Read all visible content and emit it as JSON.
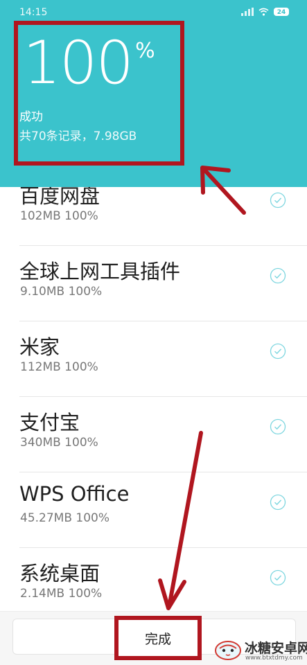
{
  "status_bar": {
    "time": "14:15",
    "battery": "24"
  },
  "header": {
    "percent_value": "100",
    "percent_sign": "%",
    "status": "成功",
    "summary": "共70条记录，7.98GB"
  },
  "apps": [
    {
      "name": "百度网盘",
      "meta": "102MB 100%",
      "completed": true
    },
    {
      "name": "全球上网工具插件",
      "meta": "9.10MB 100%",
      "completed": true
    },
    {
      "name": "米家",
      "meta": "112MB 100%",
      "completed": true
    },
    {
      "name": "支付宝",
      "meta": "340MB 100%",
      "completed": true
    },
    {
      "name": "WPS Office",
      "meta": "45.27MB 100%",
      "completed": true
    },
    {
      "name": "系统桌面",
      "meta": "2.14MB 100%",
      "completed": true
    }
  ],
  "footer": {
    "done_label": "完成"
  },
  "watermark": {
    "brand": "冰糖安卓网",
    "url": "www.btxtdmy.com"
  },
  "colors": {
    "header_bg": "#3bc3cc",
    "annotation_red": "#b0161f"
  }
}
